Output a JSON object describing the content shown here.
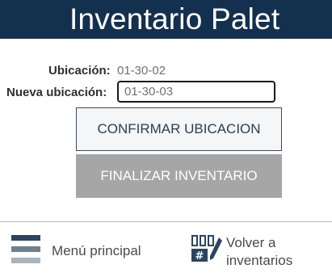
{
  "header": {
    "title": "Inventario Palet"
  },
  "form": {
    "location_label": "Ubicación:",
    "location_value": "01-30-02",
    "new_location_label": "Nueva ubicación:",
    "new_location_value": "01-30-03"
  },
  "buttons": {
    "confirm_label": "CONFIRMAR UBICACION",
    "finish_label": "FINALIZAR INVENTARIO"
  },
  "footer": {
    "menu_label": "Menú principal",
    "back_label_line1": "Volver a",
    "back_label_line2": "inventarios"
  },
  "icons": {
    "menu": "hamburger-menu-icon",
    "inventory": "inventory-grid-pencil-icon"
  },
  "colors": {
    "header_bg": "#14304f",
    "confirm_border": "#3a4a5a",
    "finish_bg": "#a6a6a6",
    "menu_icon_dark": "#2b4560",
    "menu_icon_mid": "#6f8091",
    "menu_icon_light": "#a9b4be"
  }
}
